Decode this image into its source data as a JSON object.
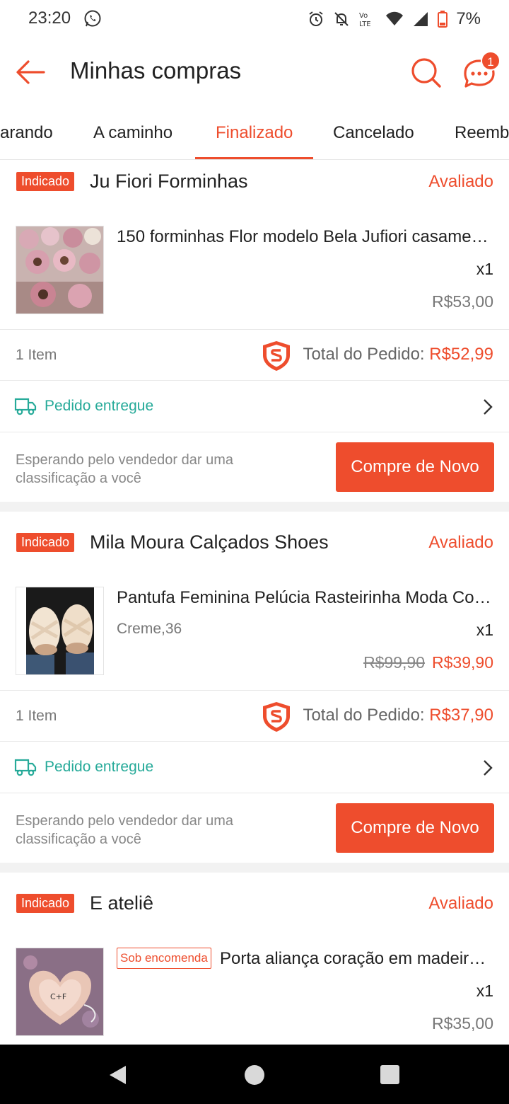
{
  "status_bar": {
    "time": "23:20",
    "battery": "7%",
    "network_label_top": "Vo",
    "network_label_bottom": "LTE"
  },
  "header": {
    "title": "Minhas compras",
    "chat_badge": "1"
  },
  "tabs": [
    {
      "label": "arando"
    },
    {
      "label": "A caminho"
    },
    {
      "label": "Finalizado",
      "active": true
    },
    {
      "label": "Cancelado"
    },
    {
      "label": "Reemb"
    }
  ],
  "orders": [
    {
      "badge": "Indicado",
      "shop": "Ju Fiori Forminhas",
      "status": "Avaliado",
      "product": {
        "name": "150 forminhas Flor modelo Bela Jufiori casame…",
        "qty": "x1",
        "price": "R$53,00"
      },
      "items": "1 Item",
      "total_label": "Total do Pedido: ",
      "total_value": "R$52,99",
      "delivery": "Pedido entregue",
      "wait": "Esperando pelo vendedor dar uma classificação a você",
      "button": "Compre de Novo"
    },
    {
      "badge": "Indicado",
      "shop": "Mila Moura Calçados Shoes",
      "status": "Avaliado",
      "product": {
        "name": "Pantufa Feminina Pelúcia Rasteirinha Moda Co…",
        "variant": "Creme,36",
        "qty": "x1",
        "old_price": "R$99,90",
        "price": "R$39,90"
      },
      "items": "1 Item",
      "total_label": "Total do Pedido: ",
      "total_value": "R$37,90",
      "delivery": "Pedido entregue",
      "wait": "Esperando pelo vendedor dar uma classificação a você",
      "button": "Compre de Novo"
    },
    {
      "badge": "Indicado",
      "shop": "E ateliê",
      "status": "Avaliado",
      "product": {
        "tag": "Sob encomenda",
        "name": "Porta aliança coração em madeir…",
        "qty": "x1",
        "price": "R$35,00"
      }
    }
  ],
  "colors": {
    "accent": "#ee4d2d",
    "teal": "#26aa99"
  }
}
